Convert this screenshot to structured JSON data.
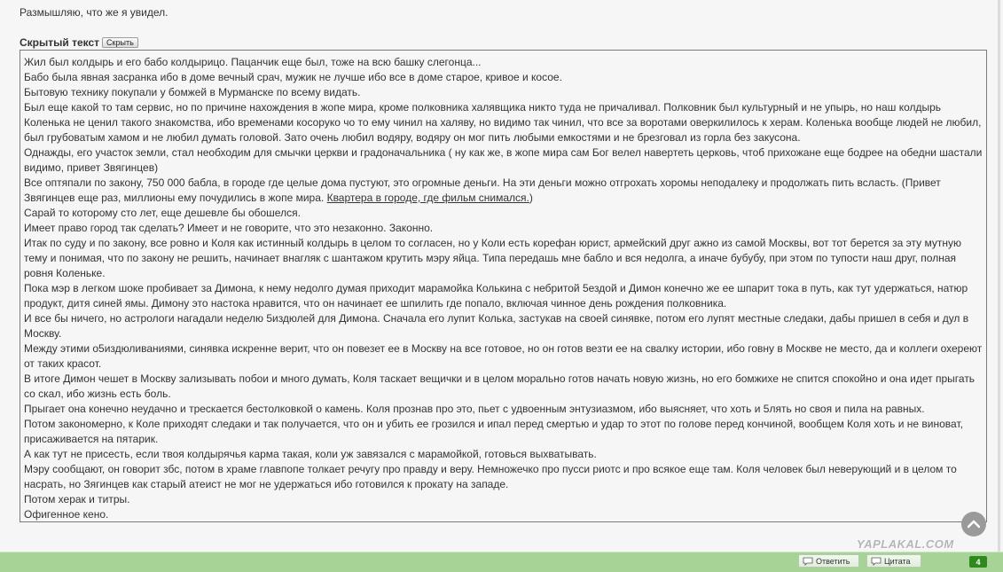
{
  "post": {
    "intro_text": "Размышляю, что же я увидел."
  },
  "spoiler": {
    "title": "Скрытый текст",
    "toggle_label": "Скрыть",
    "paragraphs": [
      "Жил был колдырь и его бабо колдырицо. Пацанчик еще был, тоже на всю башку слегонца...",
      "Бабо была явная засранка ибо в доме вечный срач, мужик не лучше ибо все в доме старое, кривое и косое.",
      "Бытовую технику покупали у бомжей в Мурманске по всему видать.",
      "Был еще какой то там сервис, но по причине нахождения в жопе мира, кроме полковника халявщика никто туда не причаливал. Полковник был культурный и не упырь, но наш колдырь Коленька не ценил такого знакомства, ибо временами косоруко чо то ему чинил на халяву, но видимо так чинил, что все за воротами оверкилилось к херам. Коленька вообще людей не любил, был грубоватым хамом и не любил думать головой. Зато очень любил водяру, водяру он мог пить любыми емкостями и не брезговал из горла без закусона.",
      "Однажды, его участок земли, стал необходим для смычки церкви и градоначальника ( ну как же, в жопе мира сам Бог велел навертеть церковь, чтоб прихожане еще бодрее на обедни шастали видимо, привет Звягинцев)",
      "Имеет право город так сделать? Имеет и не говорите, что это незаконно. Законно.",
      "Итак по суду и по закону, все ровно и Коля как истинный колдырь в целом то согласен, но у Коли есть корефан юрист, армейский друг ажно из самой Москвы, вот тот берется за эту мутную тему и понимая, что по закону не решить, начинает внагляк с шантажом крутить мэру яйца. Типа передашь мне бабло и вся недолга, а иначе бубубу, при этом по тупости наш друг, полная ровня Коленьке.",
      "Пока мэр в легком шоке пробивает за Димона, к нему недолго думая приходит марамойка Колькина с небритой 5ездой и Димон конечно же ее шпарит тока в путь, как тут удержаться, натюр продукт, дитя синей ямы. Димону это настока нравится, что он начинает ее шпилить где попало, включая чинное день рождения полковника.",
      "И все бы ничего, но астрологи нагадали неделю 5издюлей для Димона. Сначала его лупит Колька, застукав на своей синявке, потом его лупят местные следаки, дабы пришел в себя и дул в Москву.",
      "Между этими о5издюливаниями, синявка искренне верит, что он повезет ее в Москву на все готовое, но он готов везти ее на свалку истории, ибо говну в Москве не место, да и коллеги охереют от таких красот.",
      "В итоге Димон чешет в Москву зализывать побои и много думать, Коля таскает вещички и в целом морально готов начать новую жизнь, но его бомжихе не спится спокойно и она идет прыгать со скал, ибо жизнь есть боль.",
      "Прыгает она конечно неудачно и трескается бестолковкой о камень. Коля прознав про это, пьет с удвоенным энтузиазмом, ибо выясняет, что хоть и 5лять но своя и пила на равных.",
      "Потом закономерно, к Коле приходят следаки и так получается, что он и убить ее грозился и ипал перед смертью и удар то этот по голове перед кончиной, вообщем Коля хоть и не виноват, присаживается на пятарик.",
      "А как тут не присесть, если твоя колдырячья карма такая, коли уж завязался с марамойкой, готовься выхватывать.",
      "Мэру сообщают, он говорит збс, потом в храме главпопе толкает речугу про правду и веру. Немножечко про пусси риотс и про всякое еще там. Коля человек был неверующий и в целом то насрать, но Зягинцев как старый атеист не мог не удержаться ибо готовился к прокату на западе.",
      "Потом херак и титры.",
      "Офигенное кено."
    ],
    "money_paragraph": {
      "text": "Все оптяпали по закону, 750 000 бабла, в городе где целые дома пустуют, это огромные деньги. На эти деньги можно отгрохать хоромы неподалеку и продолжать пить всласть. (Привет Звягинцев еще раз, миллионы ему почудились в жопе мира. ",
      "link_text": "Квартера в городе, где фильм снимался.",
      "tail": ")"
    },
    "after_money": "Сарай то которому сто лет, еще дешевле бы обошелся."
  },
  "footer": {
    "logo_text": "YAPLAKAL.COM",
    "reply_label": "Ответить",
    "quote_label": "Цитата",
    "rating_count": "4"
  },
  "colors": {
    "bar_green": "#a8d397",
    "badge_green": "#2e8a1d"
  }
}
